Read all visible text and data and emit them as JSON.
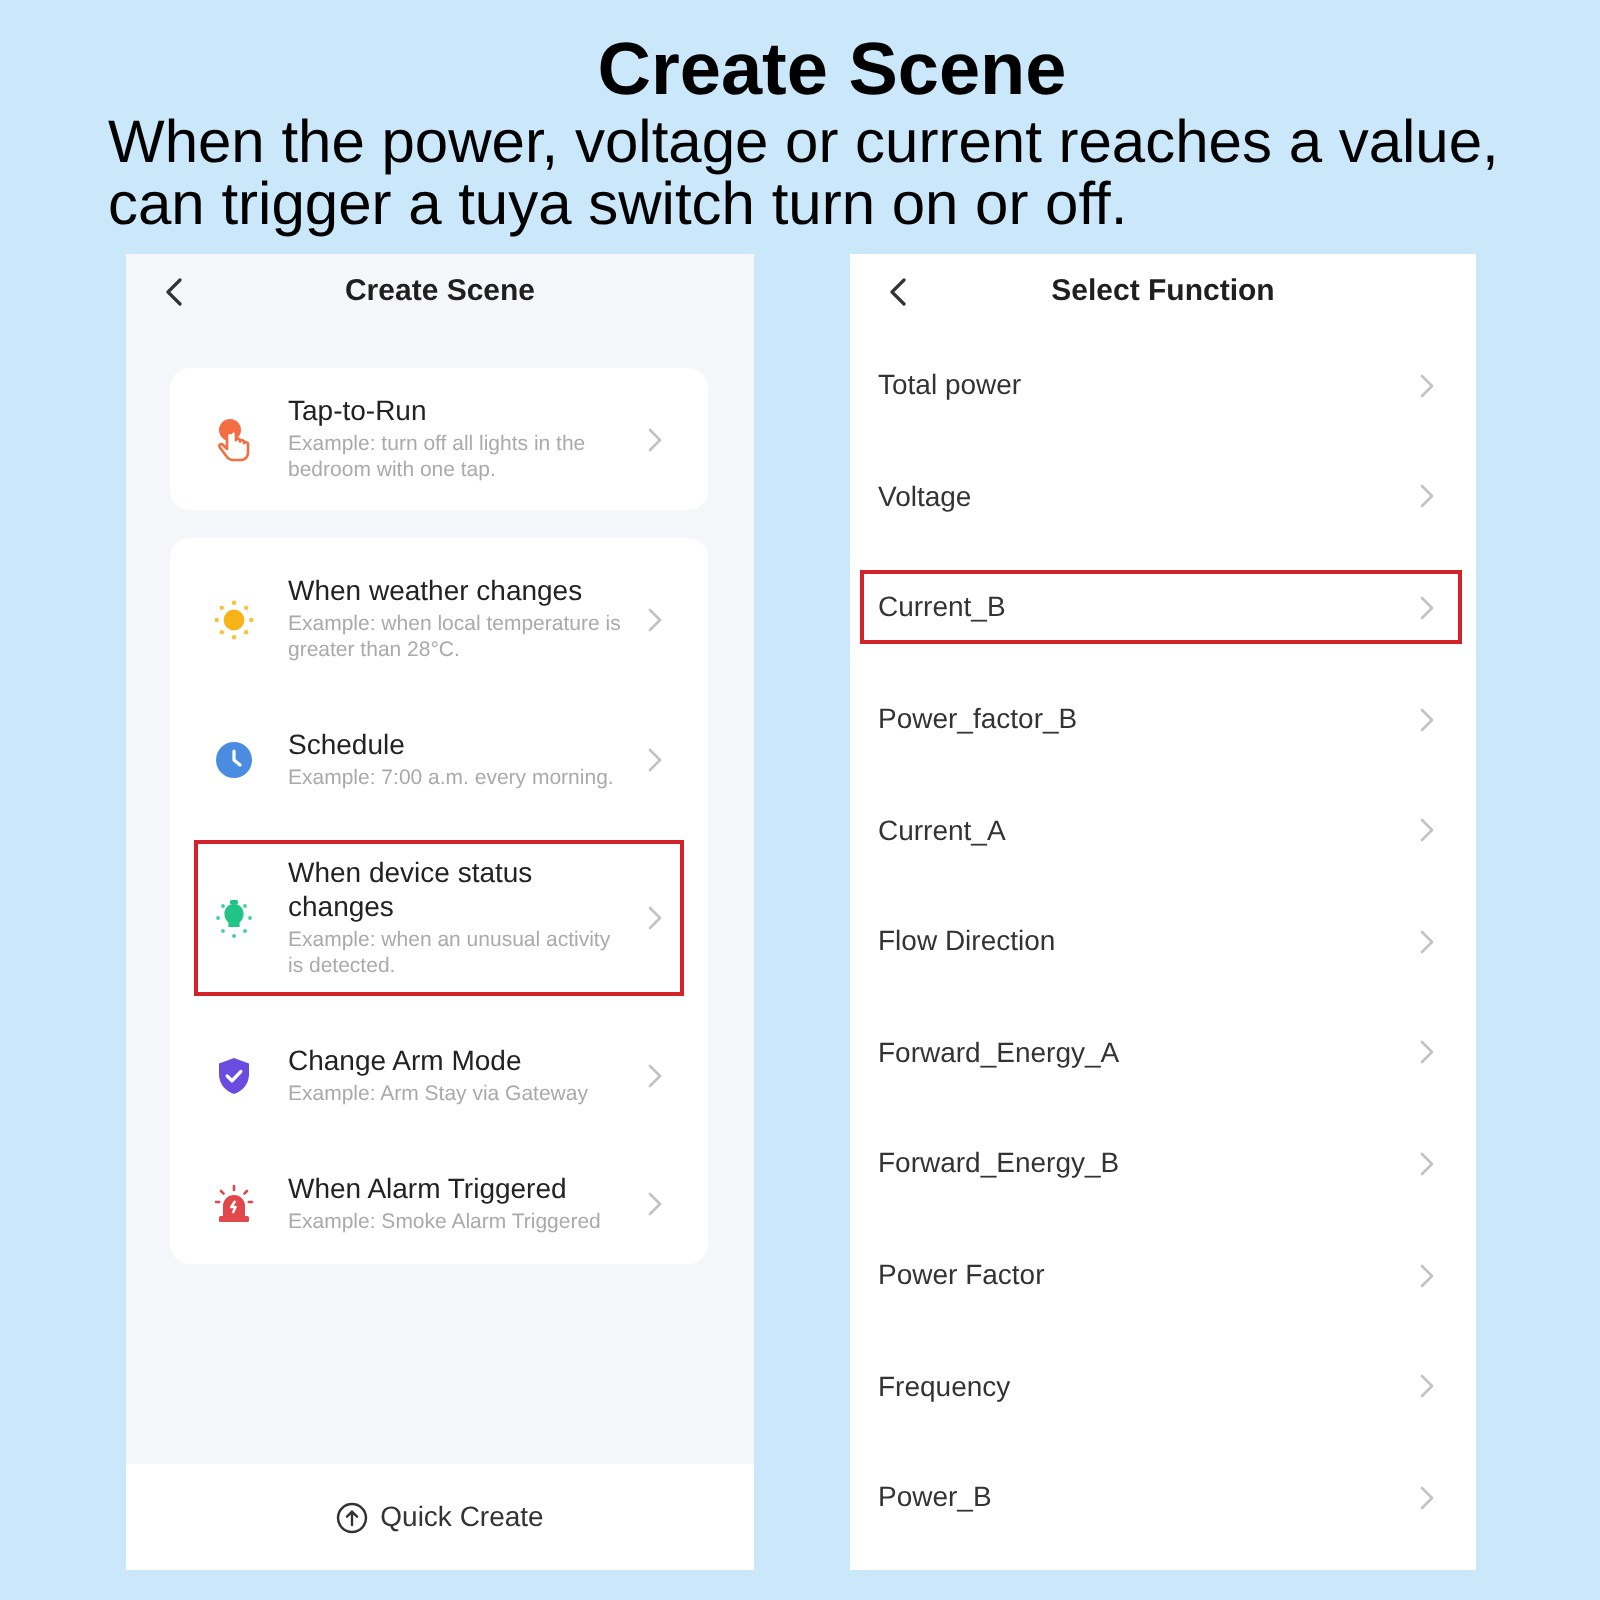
{
  "header": {
    "title": "Create Scene",
    "description": "When the power, voltage or current reaches a value, can trigger a tuya switch turn on or off."
  },
  "create_scene_screen": {
    "title": "Create Scene",
    "groups": [
      {
        "items": [
          {
            "title": "Tap-to-Run",
            "example": "Example: turn off all lights in the bedroom with one tap.",
            "highlighted": false
          }
        ]
      },
      {
        "items": [
          {
            "title": "When weather changes",
            "example": "Example: when local temperature is greater than 28°C.",
            "highlighted": false
          },
          {
            "title": "Schedule",
            "example": "Example: 7:00 a.m. every morning.",
            "highlighted": false
          },
          {
            "title": "When device status changes",
            "example": "Example: when an unusual activity is detected.",
            "highlighted": true
          },
          {
            "title": "Change Arm Mode",
            "example": "Example: Arm Stay via Gateway",
            "highlighted": false
          },
          {
            "title": "When Alarm Triggered",
            "example": "Example: Smoke Alarm Triggered",
            "highlighted": false
          }
        ]
      }
    ],
    "quick_create": "Quick Create"
  },
  "select_function_screen": {
    "title": "Select Function",
    "items": [
      {
        "label": "Total power",
        "highlighted": false
      },
      {
        "label": "Voltage",
        "highlighted": false
      },
      {
        "label": "Current_B",
        "highlighted": true
      },
      {
        "label": "Power_factor_B",
        "highlighted": false
      },
      {
        "label": "Current_A",
        "highlighted": false
      },
      {
        "label": "Flow Direction",
        "highlighted": false
      },
      {
        "label": "Forward_Energy_A",
        "highlighted": false
      },
      {
        "label": "Forward_Energy_B",
        "highlighted": false
      },
      {
        "label": "Power Factor",
        "highlighted": false
      },
      {
        "label": "Frequency",
        "highlighted": false
      },
      {
        "label": "Power_B",
        "highlighted": false
      }
    ]
  }
}
